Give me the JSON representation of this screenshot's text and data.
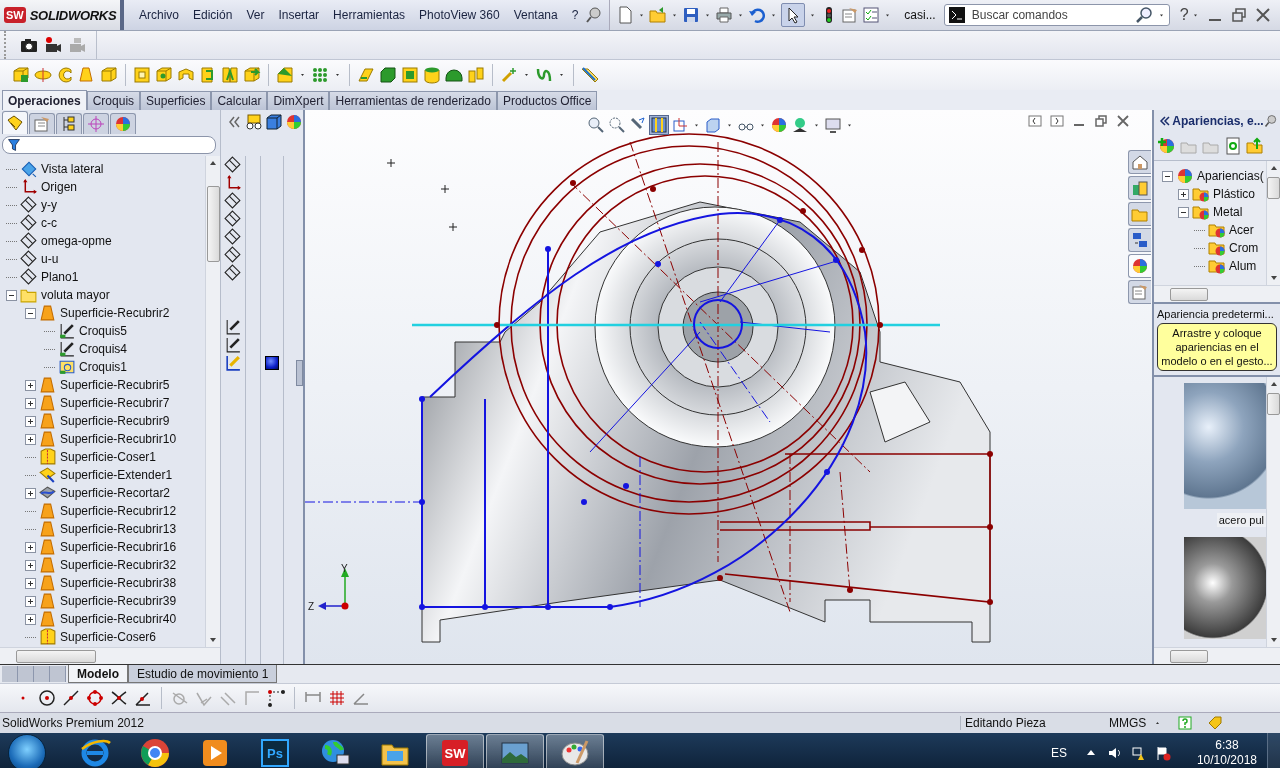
{
  "app": {
    "logo_badge": "SW",
    "logo_text": "SOLIDWORKS"
  },
  "menu": [
    "Archivo",
    "Edición",
    "Ver",
    "Insertar",
    "Herramientas",
    "PhotoView 360",
    "Ventana",
    "?"
  ],
  "document_title": "casi...",
  "search": {
    "placeholder": "Buscar comandos"
  },
  "help": "?",
  "command_tabs": [
    {
      "label": "Operaciones",
      "selected": true
    },
    {
      "label": "Croquis",
      "selected": false
    },
    {
      "label": "Superficies",
      "selected": false
    },
    {
      "label": "Calcular",
      "selected": false
    },
    {
      "label": "DimXpert",
      "selected": false
    },
    {
      "label": "Herramientas de renderizado",
      "selected": false
    },
    {
      "label": "Productos Office",
      "selected": false
    }
  ],
  "manager_tabs": [
    {
      "selected": true
    },
    {
      "selected": false
    },
    {
      "selected": false
    },
    {
      "selected": false
    },
    {
      "selected": false
    }
  ],
  "feature_tree": {
    "items": [
      {
        "label": "Vista lateral",
        "kind": "view"
      },
      {
        "label": "Origen",
        "kind": "origin"
      },
      {
        "label": "y-y",
        "kind": "plane"
      },
      {
        "label": "c-c",
        "kind": "plane"
      },
      {
        "label": "omega-opme",
        "kind": "plane"
      },
      {
        "label": "u-u",
        "kind": "plane"
      },
      {
        "label": "Plano1",
        "kind": "plane"
      },
      {
        "label": "voluta mayor",
        "kind": "folder",
        "expanded": true,
        "children": [
          {
            "label": "Superficie-Recubrir2",
            "kind": "loft",
            "expanded": true,
            "children": [
              {
                "label": "Croquis5",
                "kind": "sketch"
              },
              {
                "label": "Croquis4",
                "kind": "sketch"
              },
              {
                "label": "Croquis1",
                "kind": "sketch-appearance"
              }
            ]
          },
          {
            "label": "Superficie-Recubrir5",
            "kind": "loft",
            "expanded": false
          },
          {
            "label": "Superficie-Recubrir7",
            "kind": "loft",
            "expanded": false
          },
          {
            "label": "Superficie-Recubrir9",
            "kind": "loft",
            "expanded": false
          },
          {
            "label": "Superficie-Recubrir10",
            "kind": "loft",
            "expanded": false
          },
          {
            "label": "Superficie-Coser1",
            "kind": "knit"
          },
          {
            "label": "Superficie-Extender1",
            "kind": "extend"
          },
          {
            "label": "Superficie-Recortar2",
            "kind": "trim",
            "expanded": false
          },
          {
            "label": "Superficie-Recubrir12",
            "kind": "loft"
          },
          {
            "label": "Superficie-Recubrir13",
            "kind": "loft"
          },
          {
            "label": "Superficie-Recubrir16",
            "kind": "loft",
            "expanded": false
          },
          {
            "label": "Superficie-Recubrir32",
            "kind": "loft",
            "expanded": false
          },
          {
            "label": "Superficie-Recubrir38",
            "kind": "loft",
            "expanded": false
          },
          {
            "label": "Superficie-Recubrir39",
            "kind": "loft",
            "expanded": false
          },
          {
            "label": "Superficie-Recubrir40",
            "kind": "loft",
            "expanded": false
          },
          {
            "label": "Superficie-Coser6",
            "kind": "knit"
          }
        ]
      }
    ]
  },
  "triad": {
    "y_label": "Y",
    "z_label": "Z"
  },
  "task_pane_tabs": [
    {
      "selected": false
    },
    {
      "selected": false
    },
    {
      "selected": false
    },
    {
      "selected": false
    },
    {
      "selected": true
    },
    {
      "selected": false
    }
  ],
  "appearances": {
    "title": "Apariencias, e...",
    "tree": [
      {
        "label": "Apariencias(",
        "expanded": true,
        "children": [
          {
            "label": "Plástico",
            "expanded": false
          },
          {
            "label": "Metal",
            "expanded": true,
            "children": [
              {
                "label": "Acer"
              },
              {
                "label": "Crom"
              },
              {
                "label": "Alum"
              }
            ]
          }
        ]
      }
    ],
    "default_label": "Apariencia predetermi...",
    "hint": "Arrastre y coloque apariencias en el modelo o en el gesto...",
    "swatch_labels": [
      "acero pul"
    ]
  },
  "model_tabs": [
    {
      "label": "Modelo",
      "selected": true
    },
    {
      "label": "Estudio de movimiento 1",
      "selected": false
    }
  ],
  "status_bar": {
    "product": "SolidWorks Premium 2012",
    "mode": "Editando Pieza",
    "units": "MMGS"
  },
  "taskbar": {
    "apps": [
      {
        "kind": "browser-e",
        "running": false
      },
      {
        "kind": "browser-ring",
        "running": false
      },
      {
        "kind": "media",
        "running": false
      },
      {
        "kind": "photoshop",
        "label": "Ps",
        "running": false
      },
      {
        "kind": "globe",
        "running": false
      },
      {
        "kind": "folder",
        "running": false
      },
      {
        "kind": "solidworks",
        "label": "SW",
        "running": true
      },
      {
        "kind": "photos",
        "running": true
      },
      {
        "kind": "paint",
        "running": true
      }
    ],
    "language": "ES",
    "time": "6:38",
    "date": "10/10/2018"
  }
}
